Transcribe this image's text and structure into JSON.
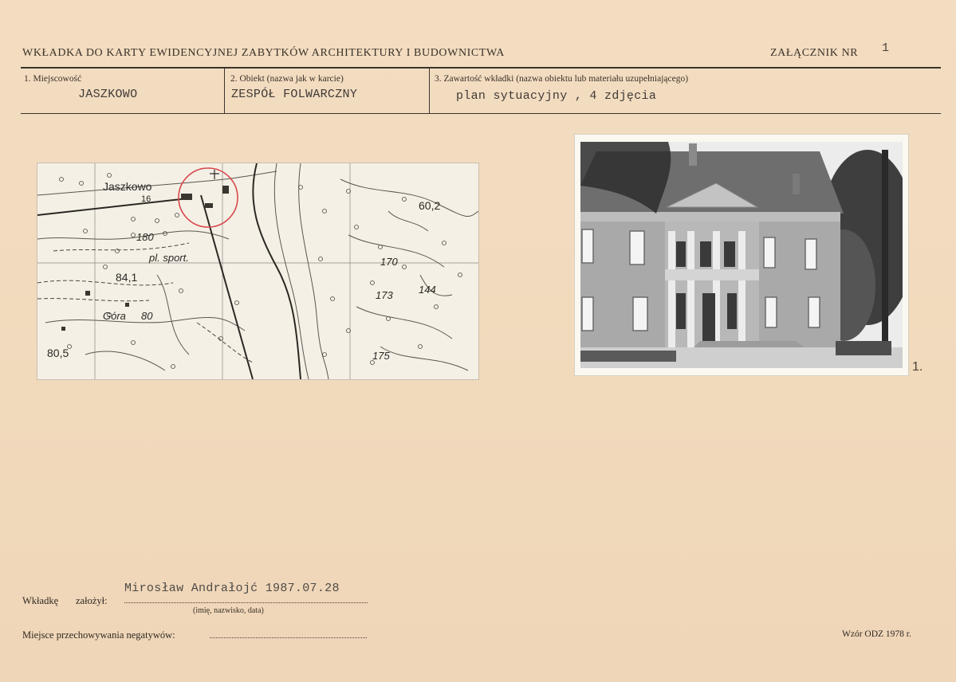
{
  "header": {
    "title": "WKŁADKA DO KARTY EWIDENCYJNEJ ZABYTKÓW  ARCHITEKTURY I BUDOWNICTWA",
    "attachment_label": "ZAŁĄCZNIK NR",
    "attachment_number": "1"
  },
  "fields": {
    "f1_label": "1.  Miejscowość",
    "f1_value": "JASZKOWO",
    "f2_label": "2.  Obiekt (nazwa jak w karcie)",
    "f2_value": "ZESPÓŁ FOLWARCZNY",
    "f3_label": "3.  Zawartość wkładki (nazwa obiektu lub materiału uzupełniającego)",
    "f3_value": "plan sytuacyjny , 4 zdjęcia"
  },
  "map": {
    "labels": [
      "Jaszkowo",
      "16",
      "60,2",
      "180",
      "pl. sport.",
      "84,1",
      "170",
      "173",
      "144",
      "Góra",
      "80",
      "80,5",
      "175"
    ]
  },
  "photo": {
    "number": "1."
  },
  "footer": {
    "author_label_1": "Wkładkę",
    "author_label_2": "założył:",
    "author_value": "Mirosław Andrałojć 1987.07.28",
    "author_caption": "(imię, nazwisko, data)",
    "negatives_label": "Miejsce przechowywania negatywów:",
    "form_id": "Wzór ODZ 1978 r."
  }
}
